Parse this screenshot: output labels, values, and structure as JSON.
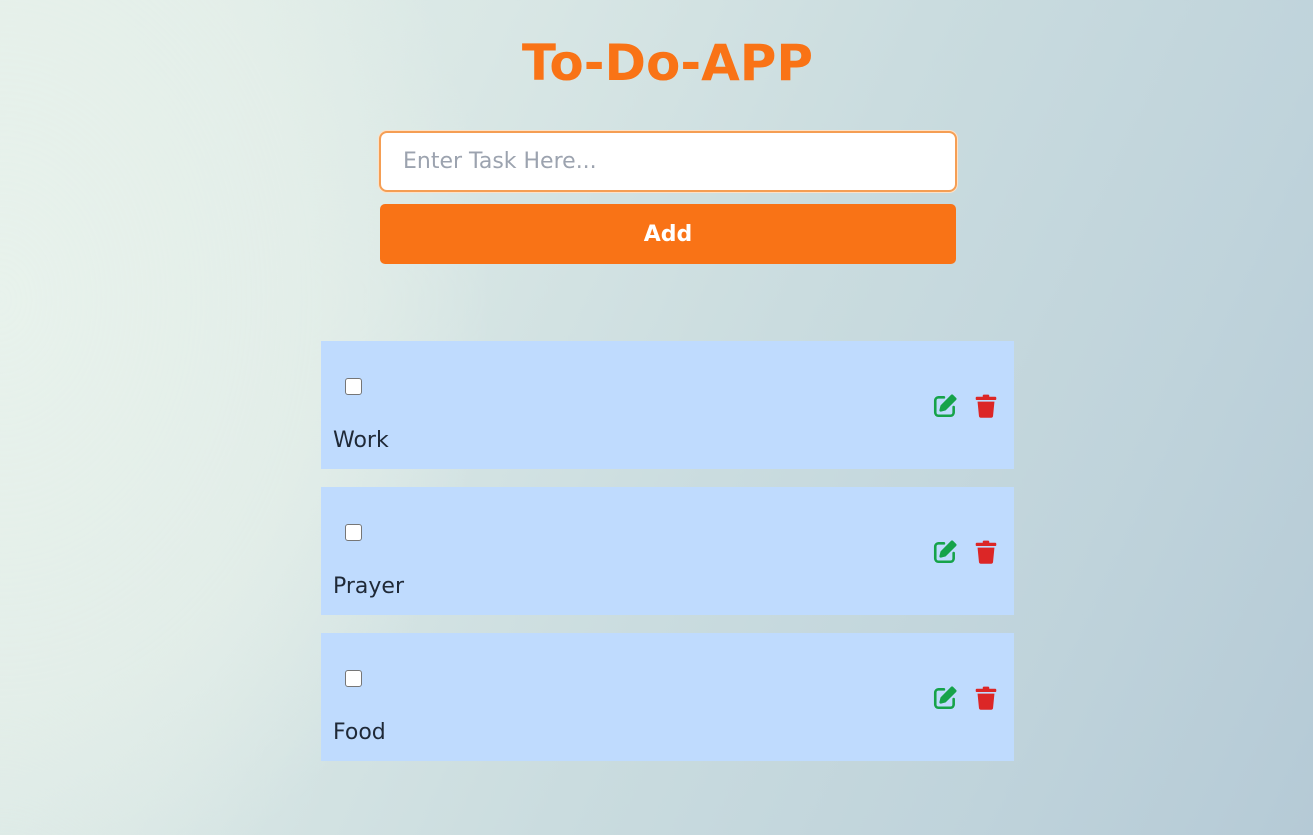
{
  "app": {
    "title": "To-Do-APP"
  },
  "form": {
    "input_placeholder": "Enter Task Here...",
    "input_value": "",
    "add_label": "Add"
  },
  "tasks": [
    {
      "text": "Work",
      "checked": false,
      "edit_icon": "edit-icon",
      "delete_icon": "trash-icon"
    },
    {
      "text": "Prayer",
      "checked": false,
      "edit_icon": "edit-icon",
      "delete_icon": "trash-icon"
    },
    {
      "text": "Food",
      "checked": false,
      "edit_icon": "edit-icon",
      "delete_icon": "trash-icon"
    }
  ],
  "colors": {
    "accent": "#f97316",
    "task_background": "#bfdbfe",
    "edit_icon": "#16a34a",
    "delete_icon": "#dc2626"
  }
}
